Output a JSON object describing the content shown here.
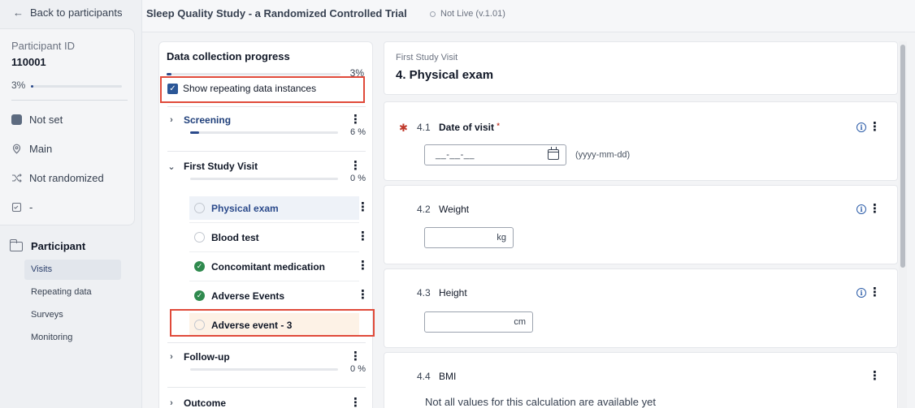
{
  "sidebar": {
    "back_label": "Back to participants",
    "participant_id_label": "Participant ID",
    "participant_id": "110001",
    "progress_pct": "3%",
    "status": "Not set",
    "site": "Main",
    "randomization": "Not randomized",
    "survey_status": "-",
    "nav_title": "Participant",
    "nav_items": [
      "Visits",
      "Repeating data",
      "Surveys",
      "Monitoring"
    ]
  },
  "header": {
    "study_title": "Sleep Quality Study - a Randomized Controlled Trial",
    "live_status": "Not Live (v.1.01)"
  },
  "progress": {
    "title": "Data collection progress",
    "overall_pct": "3%",
    "overall_fraction": 0.03,
    "show_repeating_label": "Show repeating data instances",
    "sections": [
      {
        "name": "Screening",
        "pct": "6 %",
        "fraction": 0.06
      },
      {
        "name": "First Study Visit",
        "pct": "0 %",
        "fraction": 0.0
      },
      {
        "name": "Follow-up",
        "pct": "0 %",
        "fraction": 0.0
      },
      {
        "name": "Outcome",
        "pct": "",
        "fraction": 0.0
      }
    ],
    "forms": [
      {
        "name": "Physical exam",
        "status": "empty"
      },
      {
        "name": "Blood test",
        "status": "empty"
      },
      {
        "name": "Concomitant medication",
        "status": "complete"
      },
      {
        "name": "Adverse Events",
        "status": "complete"
      },
      {
        "name": "Adverse event - 3",
        "status": "empty"
      }
    ]
  },
  "form": {
    "visit_name": "First Study Visit",
    "form_title": "4. Physical exam",
    "questions": [
      {
        "number": "4.1",
        "label": "Date of visit",
        "required_mark": "*",
        "placeholder": "__-__-__",
        "hint": "(yyyy-mm-dd)"
      },
      {
        "number": "4.2",
        "label": "Weight",
        "unit": "kg"
      },
      {
        "number": "4.3",
        "label": "Height",
        "unit": "cm"
      },
      {
        "number": "4.4",
        "label": "BMI",
        "message": "Not all values for this calculation are available yet"
      }
    ]
  },
  "colors": {
    "accent": "#2b4a8b",
    "complete": "#2f8a4e",
    "required": "#c0392b",
    "highlight_box": "#e04a3a"
  }
}
